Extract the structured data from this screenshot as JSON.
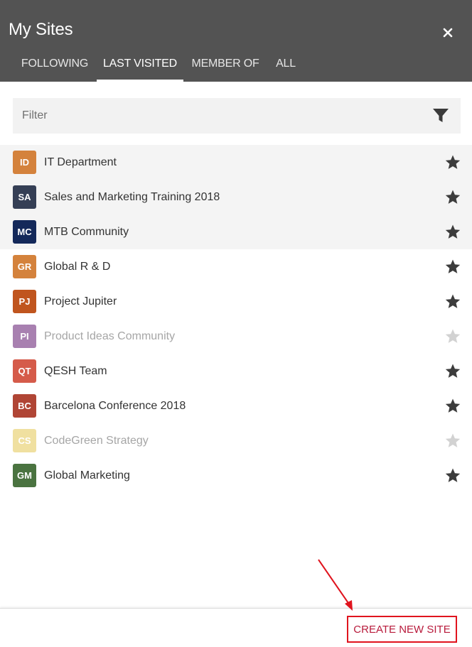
{
  "header": {
    "title": "My Sites",
    "close_icon": "close-icon"
  },
  "tabs": [
    {
      "label": "FOLLOWING",
      "active": false
    },
    {
      "label": "LAST VISITED",
      "active": true
    },
    {
      "label": "MEMBER OF",
      "active": false
    },
    {
      "label": "ALL",
      "active": false
    }
  ],
  "filter": {
    "placeholder": "Filter",
    "value": "",
    "icon": "filter-icon"
  },
  "sites": [
    {
      "initials": "ID",
      "name": "IT Department",
      "color": "#d4823c",
      "favorited": true,
      "highlighted": true,
      "dimmed": false
    },
    {
      "initials": "SA",
      "name": "Sales and Marketing Training 2018",
      "color": "#353f55",
      "favorited": true,
      "highlighted": true,
      "dimmed": false
    },
    {
      "initials": "MC",
      "name": "MTB Community",
      "color": "#14295a",
      "favorited": true,
      "highlighted": true,
      "dimmed": false
    },
    {
      "initials": "GR",
      "name": "Global R & D",
      "color": "#d4823c",
      "favorited": true,
      "highlighted": false,
      "dimmed": false
    },
    {
      "initials": "PJ",
      "name": "Project Jupiter",
      "color": "#c0551e",
      "favorited": true,
      "highlighted": false,
      "dimmed": false
    },
    {
      "initials": "PI",
      "name": "Product Ideas Community",
      "color": "#a880b0",
      "favorited": false,
      "highlighted": false,
      "dimmed": true
    },
    {
      "initials": "QT",
      "name": "QESH Team",
      "color": "#d55b4a",
      "favorited": true,
      "highlighted": false,
      "dimmed": false
    },
    {
      "initials": "BC",
      "name": "Barcelona Conference 2018",
      "color": "#b04535",
      "favorited": true,
      "highlighted": false,
      "dimmed": false
    },
    {
      "initials": "CS",
      "name": "CodeGreen Strategy",
      "color": "#f0e0a0",
      "favorited": false,
      "highlighted": false,
      "dimmed": true
    },
    {
      "initials": "GM",
      "name": "Global Marketing",
      "color": "#4a7340",
      "favorited": true,
      "highlighted": false,
      "dimmed": false
    }
  ],
  "colors": {
    "header_bg": "#535353",
    "star_active": "#3c3c3c",
    "star_inactive": "#d2d2d2",
    "create_text": "#b81b3c",
    "annotation_red": "#e0141e"
  },
  "footer": {
    "create_label": "CREATE NEW SITE"
  }
}
